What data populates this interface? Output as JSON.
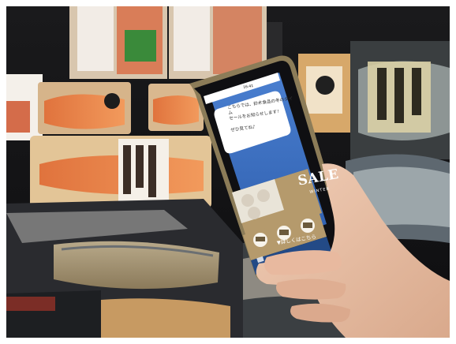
{
  "scene": {
    "description_hidden": "",
    "colors": {
      "background": "#151517",
      "phone_body": "#8a7a55",
      "screen_blue": "#3f73c4",
      "sale_panel": "#b69a6d",
      "hand": "#e6bfa6"
    }
  },
  "phone": {
    "status_time": "16:41",
    "chat_message": "こちらでは、鈴木食品の冬のタイム\nセールをお知らせします！\n\nぜひ見てね♪",
    "chat_message_2": "",
    "sale_title": "SALE",
    "sale_subtitle": "WINTER",
    "cta_label": "▼詳しくはこちら",
    "icons": [
      "shop-icon",
      "book-icon",
      "chat-icon"
    ]
  }
}
